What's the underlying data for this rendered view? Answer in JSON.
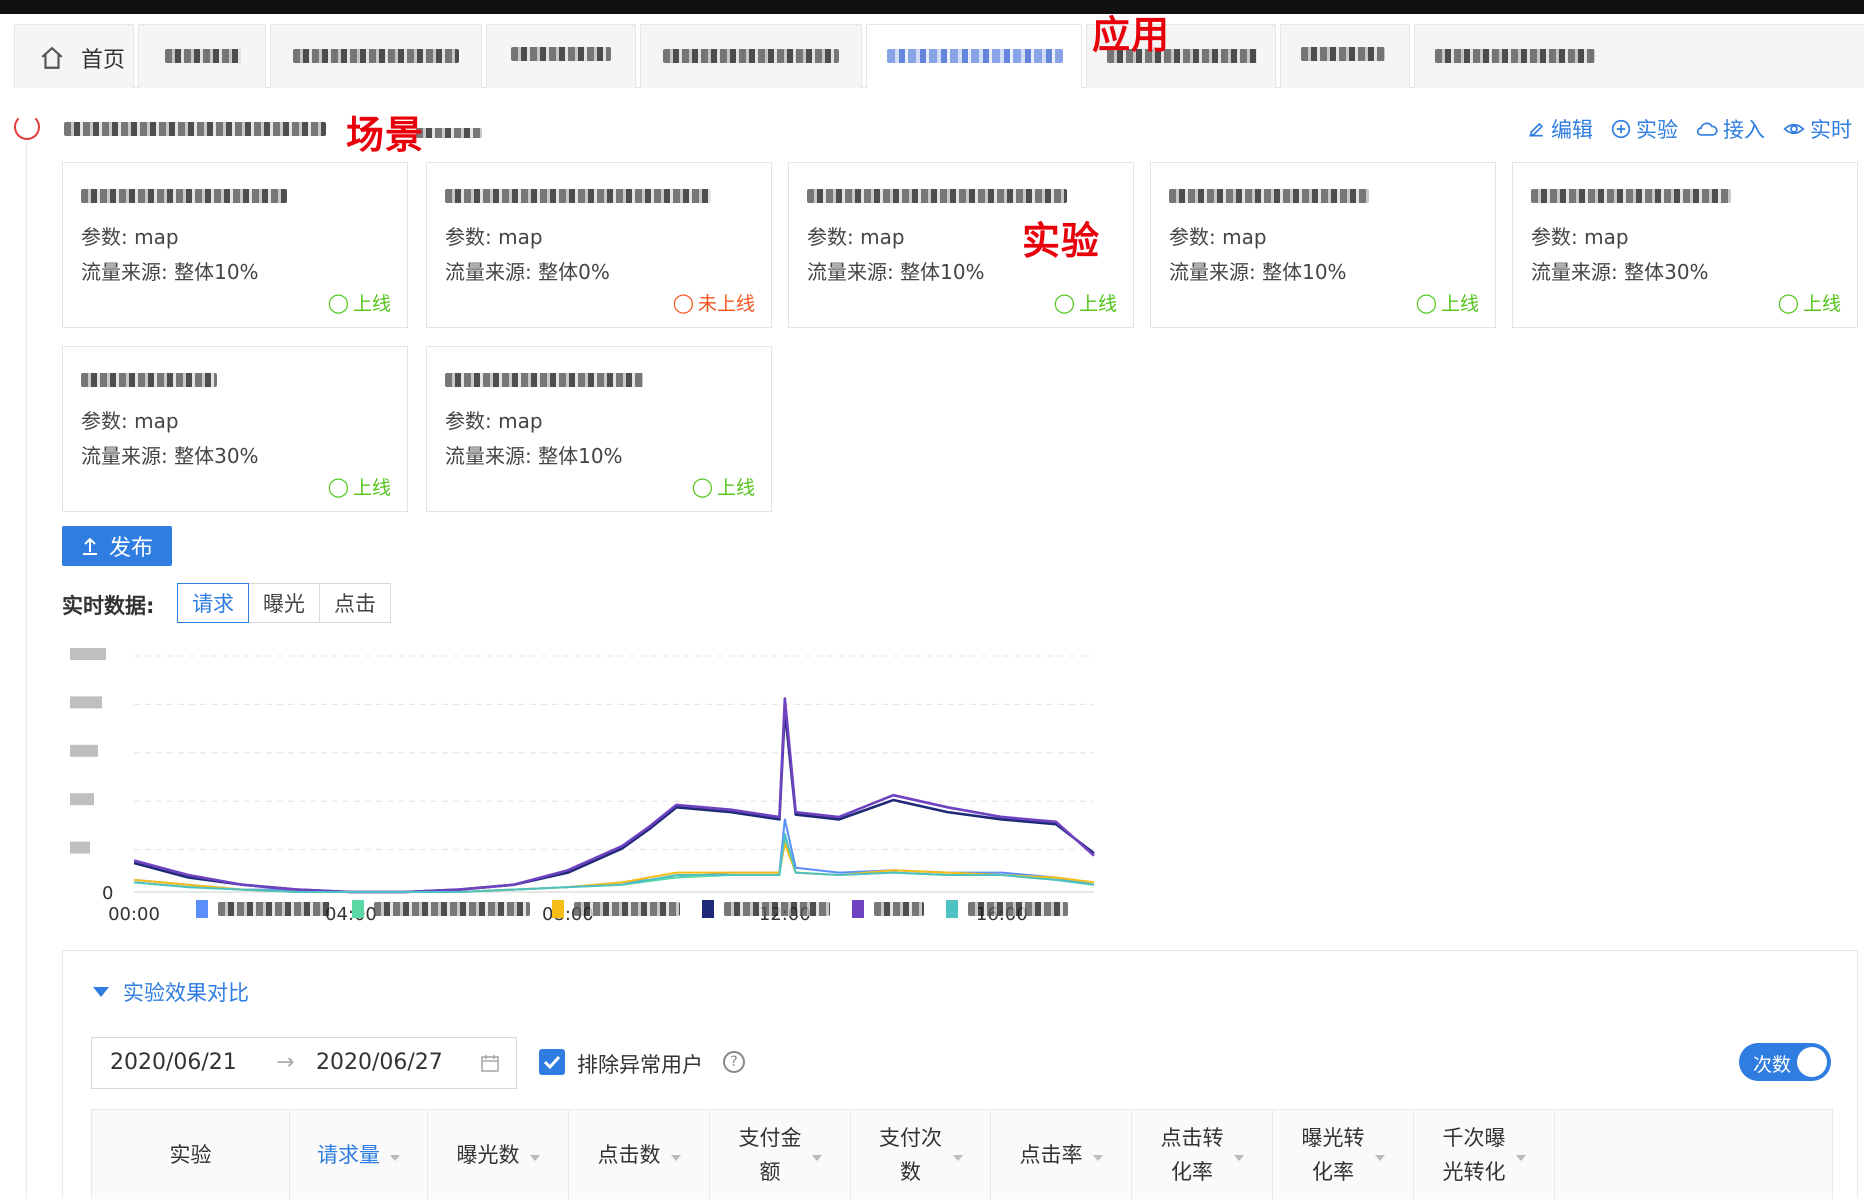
{
  "annotations": {
    "app": "应用",
    "scene": "场景",
    "experiment": "实验"
  },
  "tabs": [
    {
      "label": "首页",
      "icon": "home-icon"
    },
    {
      "label": ""
    },
    {
      "label": ""
    },
    {
      "label": ""
    },
    {
      "label": ""
    },
    {
      "label": ""
    },
    {
      "label": ""
    },
    {
      "label": ""
    },
    {
      "label": ""
    }
  ],
  "scene_actions": {
    "edit": "编辑",
    "experiment": "实验",
    "connect": "接入",
    "realtime": "实时"
  },
  "experiment_cards": [
    {
      "param": "参数: map",
      "traffic": "流量来源: 整体10%",
      "status": "上线",
      "online": true
    },
    {
      "param": "参数: map",
      "traffic": "流量来源: 整体0%",
      "status": "未上线",
      "online": false
    },
    {
      "param": "参数: map",
      "traffic": "流量来源: 整体10%",
      "status": "上线",
      "online": true
    },
    {
      "param": "参数: map",
      "traffic": "流量来源: 整体10%",
      "status": "上线",
      "online": true
    },
    {
      "param": "参数: map",
      "traffic": "流量来源: 整体30%",
      "status": "上线",
      "online": true
    },
    {
      "param": "参数: map",
      "traffic": "流量来源: 整体30%",
      "status": "上线",
      "online": true
    },
    {
      "param": "参数: map",
      "traffic": "流量来源: 整体10%",
      "status": "上线",
      "online": true
    }
  ],
  "publish_label": "发布",
  "realtime": {
    "label": "实时数据:",
    "segments": [
      "请求",
      "曝光",
      "点击"
    ],
    "active": "请求"
  },
  "chart_data": {
    "type": "line",
    "x_ticks": [
      "00:00",
      "04:00",
      "08:00",
      "12:00",
      "16:00"
    ],
    "y_ticks": [
      "0"
    ],
    "x_range_hours": [
      0,
      17.7
    ],
    "ylim": [
      0,
      100
    ],
    "grid": true,
    "legend_position": "bottom",
    "series": [
      {
        "color": "#5b8ff9",
        "x": [
          0,
          1,
          2,
          3,
          4,
          5,
          6,
          7,
          8,
          9,
          10,
          11,
          11.9,
          12,
          12.2,
          13,
          14,
          15,
          16,
          17,
          17.7
        ],
        "values": [
          5,
          3,
          1,
          1,
          0,
          0,
          0,
          1,
          2,
          4,
          6,
          8,
          8,
          30,
          10,
          8,
          9,
          8,
          8,
          6,
          3
        ]
      },
      {
        "color": "#5ad8a6",
        "x": [
          0,
          1,
          2,
          3,
          4,
          5,
          6,
          7,
          8,
          9,
          10,
          11,
          11.9,
          12,
          12.2,
          13,
          14,
          15,
          16,
          17,
          17.7
        ],
        "values": [
          4,
          2,
          1,
          0,
          0,
          0,
          0,
          1,
          2,
          3,
          6,
          7,
          7,
          22,
          8,
          7,
          8,
          7,
          7,
          5,
          3
        ]
      },
      {
        "color": "#f6bd16",
        "x": [
          0,
          1,
          2,
          3,
          4,
          5,
          6,
          7,
          8,
          9,
          10,
          11,
          11.9,
          12,
          12.2,
          13,
          14,
          15,
          16,
          17,
          17.7
        ],
        "values": [
          5,
          3,
          1,
          0,
          0,
          0,
          0,
          1,
          2,
          4,
          8,
          8,
          8,
          20,
          8,
          7,
          9,
          8,
          7,
          6,
          4
        ]
      },
      {
        "color": "#1e2a78",
        "x": [
          0,
          1,
          2,
          3,
          4,
          5,
          6,
          7,
          8,
          9,
          9.5,
          10,
          11,
          11.9,
          12,
          12.2,
          13,
          14,
          15,
          16,
          17,
          17.7
        ],
        "values": [
          12,
          6,
          3,
          1,
          0,
          0,
          1,
          3,
          8,
          18,
          26,
          35,
          33,
          30,
          75,
          32,
          30,
          38,
          33,
          30,
          28,
          16
        ]
      },
      {
        "color": "#6f42c1",
        "x": [
          0,
          1,
          2,
          3,
          4,
          5,
          6,
          7,
          8,
          9,
          9.5,
          10,
          11,
          11.9,
          12,
          12.2,
          13,
          14,
          15,
          16,
          17,
          17.7
        ],
        "values": [
          13,
          7,
          3,
          1,
          0,
          0,
          1,
          3,
          9,
          19,
          27,
          36,
          34,
          31,
          80,
          33,
          31,
          40,
          35,
          31,
          29,
          15
        ]
      },
      {
        "color": "#4ec2c2",
        "x": [
          0,
          1,
          2,
          3,
          4,
          5,
          6,
          7,
          8,
          9,
          10,
          11,
          11.9,
          12,
          12.2,
          13,
          14,
          15,
          16,
          17,
          17.7
        ],
        "values": [
          4,
          2,
          1,
          0,
          0,
          0,
          0,
          1,
          2,
          3,
          7,
          7,
          7,
          24,
          8,
          7,
          8,
          7,
          7,
          5,
          3
        ]
      }
    ]
  },
  "comparison": {
    "title": "实验效果对比",
    "date_start": "2020/06/21",
    "date_end": "2020/06/27",
    "exclude_label": "排除异常用户",
    "toggle_label": "次数",
    "columns": [
      {
        "label": "实验",
        "sortable": false,
        "active": false
      },
      {
        "label": "请求量",
        "sortable": true,
        "active": true
      },
      {
        "label": "曝光数",
        "sortable": true,
        "active": false
      },
      {
        "label": "点击数",
        "sortable": true,
        "active": false
      },
      {
        "label": "支付金额",
        "sortable": true,
        "active": false
      },
      {
        "label": "支付次数",
        "sortable": true,
        "active": false
      },
      {
        "label": "点击率",
        "sortable": true,
        "active": false
      },
      {
        "label": "点击转化率",
        "sortable": true,
        "active": false
      },
      {
        "label": "曝光转化率",
        "sortable": true,
        "active": false
      },
      {
        "label": "千次曝光转化",
        "sortable": true,
        "active": false
      }
    ]
  }
}
